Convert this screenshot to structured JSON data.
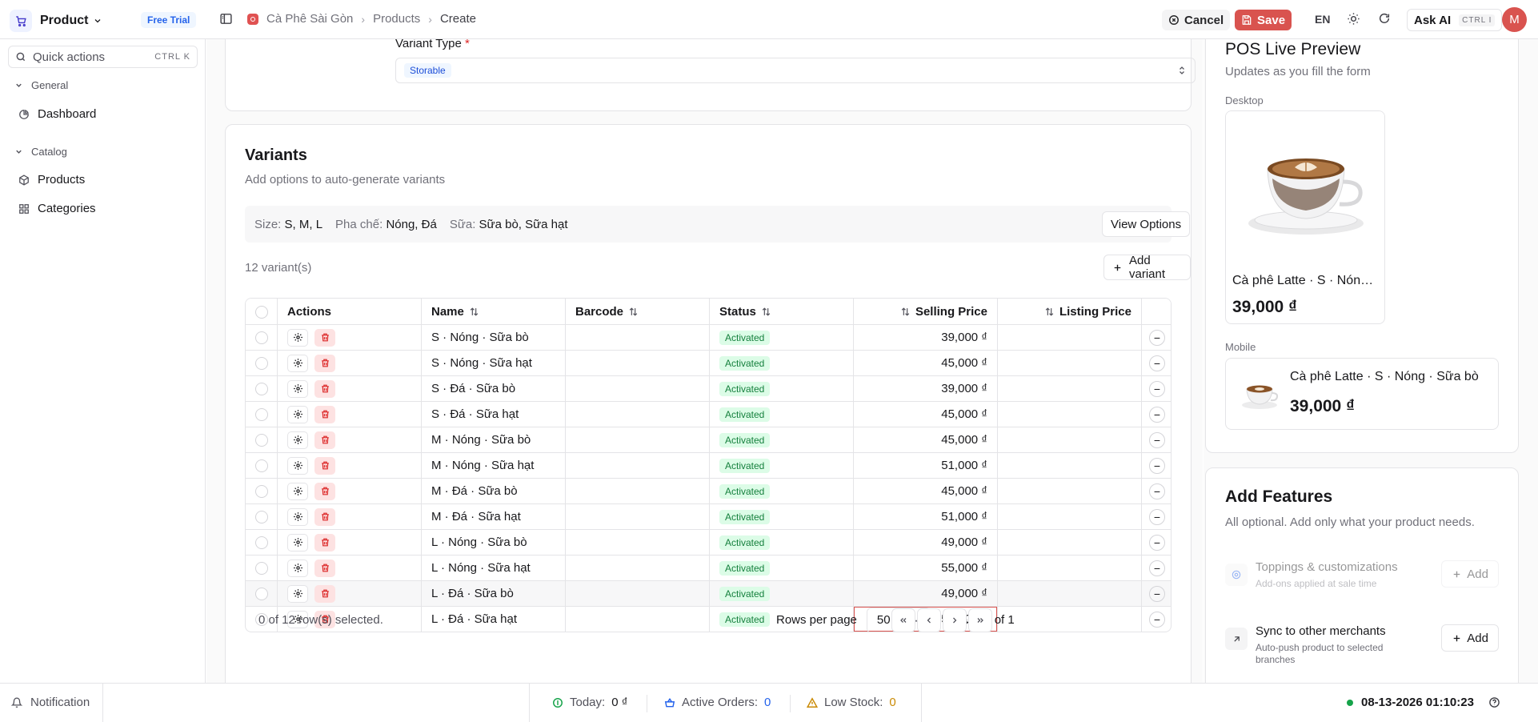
{
  "header": {
    "app_name": "Product",
    "trial_badge": "Free Trial",
    "breadcrumb": [
      "Cà Phê Sài Gòn",
      "Products",
      "Create"
    ],
    "cancel_label": "Cancel",
    "save_label": "Save",
    "language": "EN",
    "ask_ai_label": "Ask AI",
    "ask_ai_shortcut": "CTRL I",
    "avatar_initial": "M"
  },
  "sidebar": {
    "quick_actions": "Quick actions",
    "quick_actions_shortcut": "CTRL K",
    "groups": [
      {
        "label": "General",
        "items": [
          {
            "label": "Dashboard",
            "icon": "pie-chart-icon"
          }
        ]
      },
      {
        "label": "Catalog",
        "items": [
          {
            "label": "Products",
            "icon": "package-icon"
          },
          {
            "label": "Categories",
            "icon": "grid-icon"
          }
        ]
      }
    ]
  },
  "form": {
    "variant_type_label": "Variant Type",
    "variant_type_required": "*",
    "variant_type_value": "Storable"
  },
  "variants": {
    "title": "Variants",
    "subtitle": "Add options to auto-generate variants",
    "options": [
      {
        "key": "Size:",
        "value": "S, M, L"
      },
      {
        "key": "Pha chế:",
        "value": "Nóng, Đá"
      },
      {
        "key": "Sữa:",
        "value": "Sữa bò, Sữa hạt"
      }
    ],
    "view_options_label": "View Options",
    "count_text": "12 variant(s)",
    "add_variant_label": "Add variant",
    "columns": [
      "Actions",
      "Name",
      "Barcode",
      "Status",
      "Selling Price",
      "Listing Price"
    ],
    "rows": [
      {
        "name": "S · Nóng · Sữa bò",
        "barcode": "",
        "status": "Activated",
        "selling_price": "39,000 ₫",
        "listing_price": ""
      },
      {
        "name": "S · Nóng · Sữa hạt",
        "barcode": "",
        "status": "Activated",
        "selling_price": "45,000 ₫",
        "listing_price": ""
      },
      {
        "name": "S · Đá · Sữa bò",
        "barcode": "",
        "status": "Activated",
        "selling_price": "39,000 ₫",
        "listing_price": ""
      },
      {
        "name": "S · Đá · Sữa hạt",
        "barcode": "",
        "status": "Activated",
        "selling_price": "45,000 ₫",
        "listing_price": ""
      },
      {
        "name": "M · Nóng · Sữa bò",
        "barcode": "",
        "status": "Activated",
        "selling_price": "45,000 ₫",
        "listing_price": ""
      },
      {
        "name": "M · Nóng · Sữa hạt",
        "barcode": "",
        "status": "Activated",
        "selling_price": "51,000 ₫",
        "listing_price": ""
      },
      {
        "name": "M · Đá · Sữa bò",
        "barcode": "",
        "status": "Activated",
        "selling_price": "45,000 ₫",
        "listing_price": ""
      },
      {
        "name": "M · Đá · Sữa hạt",
        "barcode": "",
        "status": "Activated",
        "selling_price": "51,000 ₫",
        "listing_price": ""
      },
      {
        "name": "L · Nóng · Sữa bò",
        "barcode": "",
        "status": "Activated",
        "selling_price": "49,000 ₫",
        "listing_price": ""
      },
      {
        "name": "L · Nóng · Sữa hạt",
        "barcode": "",
        "status": "Activated",
        "selling_price": "55,000 ₫",
        "listing_price": ""
      },
      {
        "name": "L · Đá · Sữa bò",
        "barcode": "",
        "status": "Activated",
        "selling_price": "49,000 ₫",
        "listing_price": ""
      },
      {
        "name": "L · Đá · Sữa hạt",
        "barcode": "",
        "status": "Activated",
        "selling_price": "55,000 ₫",
        "listing_price": ""
      }
    ],
    "selection_text": "0 of 12 row(s) selected.",
    "rows_per_page_label": "Rows per page",
    "rows_per_page_value": "50",
    "page_info": "Page 1 of 1"
  },
  "preview": {
    "title": "POS Live Preview",
    "subtitle": "Updates as you fill the form",
    "desktop_label": "Desktop",
    "mobile_label": "Mobile",
    "product_name": "Cà phê Latte · S · Nóng · Sữa bò",
    "product_price": "39,000 ₫"
  },
  "features": {
    "title": "Add Features",
    "subtitle": "All optional. Add only what your product needs.",
    "items": [
      {
        "name": "Toppings & customizations",
        "desc": "Add-ons applied at sale time",
        "add_label": "Add",
        "disabled": true
      },
      {
        "name": "Sync to other merchants",
        "desc": "Auto-push product to selected branches",
        "add_label": "Add",
        "disabled": false
      }
    ]
  },
  "statusbar": {
    "notification": "Notification",
    "today_label": "Today:",
    "today_value": "0 ₫",
    "orders_label": "Active Orders:",
    "orders_value": "0",
    "stock_label": "Low Stock:",
    "stock_value": "0",
    "clock": "08-13-2026 01:10:23"
  },
  "colors": {
    "accent": "#d9534f",
    "success": "#16a34a",
    "info": "#2563eb"
  }
}
